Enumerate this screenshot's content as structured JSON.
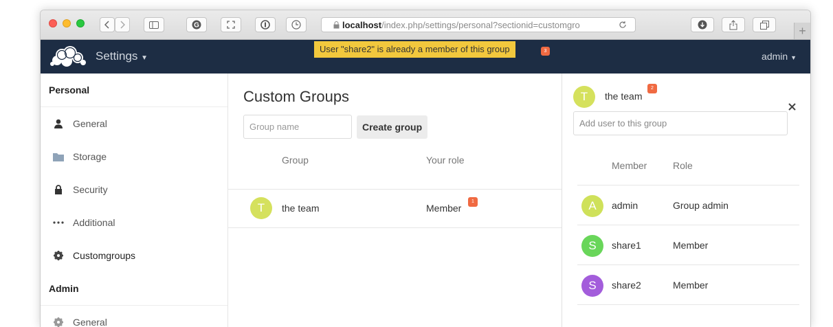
{
  "browser": {
    "url_host": "localhost",
    "url_path": "/index.php/settings/personal?sectionid=customgro",
    "icons": [
      "back-icon",
      "forward-icon",
      "sidebar-icon",
      "grammarly-icon",
      "fullscreen-icon",
      "password-icon",
      "history-icon",
      "lock-icon",
      "reload-icon",
      "download-icon",
      "share-icon",
      "tabs-icon",
      "new-tab-icon"
    ]
  },
  "header": {
    "app_title": "Settings",
    "notification": "User \"share2\" is already a member of this group",
    "notification_badge": "3",
    "user": "admin"
  },
  "sidebar": {
    "personal_heading": "Personal",
    "personal_items": [
      {
        "label": "General",
        "icon": "user-icon"
      },
      {
        "label": "Storage",
        "icon": "folder-icon"
      },
      {
        "label": "Security",
        "icon": "lock-icon"
      },
      {
        "label": "Additional",
        "icon": "more-icon"
      },
      {
        "label": "Customgroups",
        "icon": "gear-icon"
      }
    ],
    "admin_heading": "Admin",
    "admin_items": [
      {
        "label": "General",
        "icon": "gear-icon"
      }
    ]
  },
  "main": {
    "title": "Custom Groups",
    "group_name_placeholder": "Group name",
    "create_button": "Create group",
    "columns": {
      "group": "Group",
      "role": "Your role"
    },
    "rows": [
      {
        "avatar_letter": "T",
        "avatar_color": "#d5e15d",
        "group": "the team",
        "role": "Member",
        "badge": "1"
      }
    ]
  },
  "panel": {
    "avatar_letter": "T",
    "avatar_color": "#d5e15d",
    "group": "the team",
    "badge": "2",
    "add_placeholder": "Add user to this group",
    "columns": {
      "member": "Member",
      "role": "Role"
    },
    "members": [
      {
        "letter": "A",
        "color": "#cfe15a",
        "name": "admin",
        "role": "Group admin"
      },
      {
        "letter": "S",
        "color": "#69d65a",
        "name": "share1",
        "role": "Member"
      },
      {
        "letter": "S",
        "color": "#a35ddb",
        "name": "share2",
        "role": "Member"
      }
    ]
  }
}
